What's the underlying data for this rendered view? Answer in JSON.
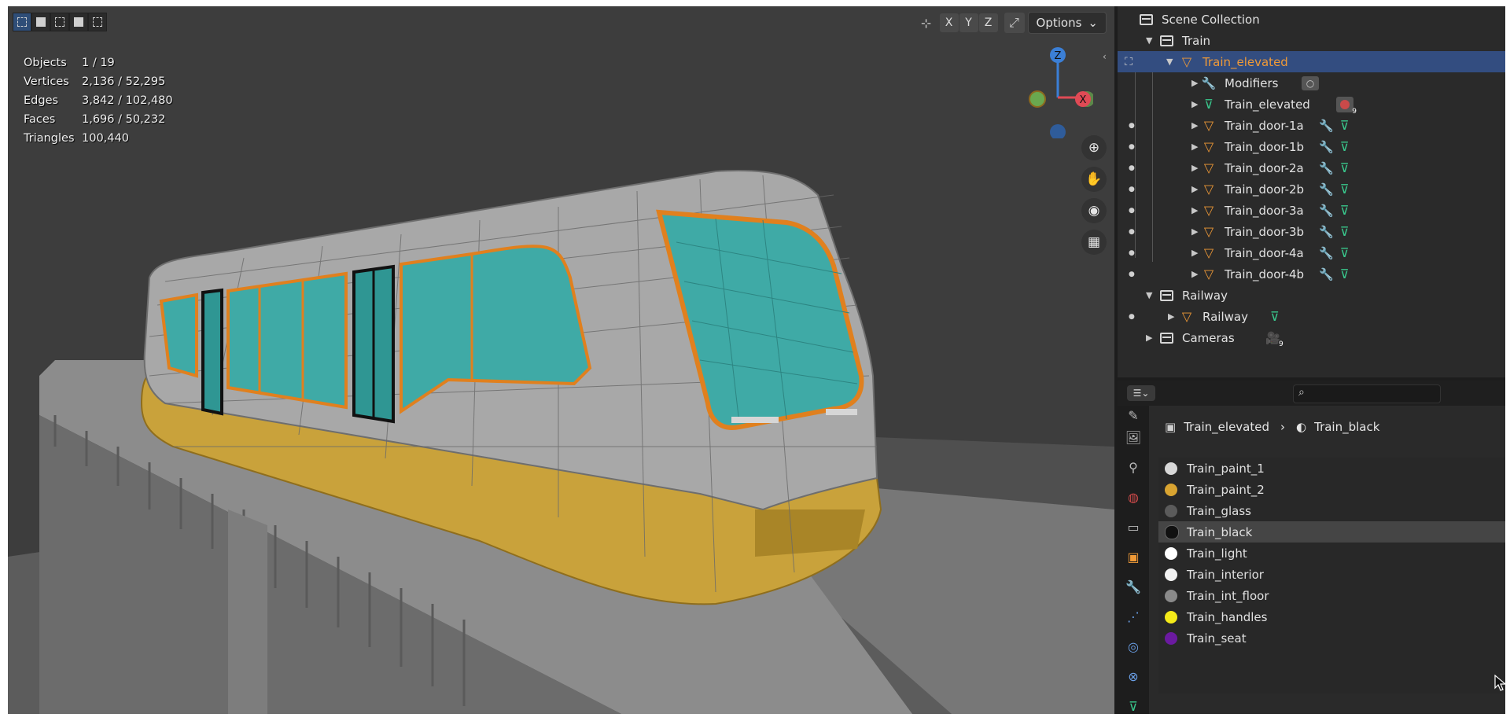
{
  "viewport": {
    "options_label": "Options",
    "axes": [
      "X",
      "Y",
      "Z"
    ],
    "stats": [
      {
        "label": "Objects",
        "value": "1 / 19"
      },
      {
        "label": "Vertices",
        "value": "2,136 / 52,295"
      },
      {
        "label": "Edges",
        "value": "3,842 / 102,480"
      },
      {
        "label": "Faces",
        "value": "1,696 / 50,232"
      },
      {
        "label": "Triangles",
        "value": "100,440"
      }
    ],
    "gizmo": {
      "z": "Z",
      "x": "X"
    }
  },
  "outliner": {
    "scene_collection": "Scene Collection",
    "train_collection": "Train",
    "train_elevated": "Train_elevated",
    "modifiers": "Modifiers",
    "mesh_data": "Train_elevated",
    "material_count": "9",
    "doors": [
      "Train_door-1a",
      "Train_door-1b",
      "Train_door-2a",
      "Train_door-2b",
      "Train_door-3a",
      "Train_door-3b",
      "Train_door-4a",
      "Train_door-4b"
    ],
    "railway_collection": "Railway",
    "railway_object": "Railway",
    "cameras_collection": "Cameras",
    "camera_count": "9"
  },
  "properties": {
    "breadcrumb": {
      "object": "Train_elevated",
      "material": "Train_black"
    },
    "materials": [
      {
        "name": "Train_paint_1",
        "color": "#d8d8d8"
      },
      {
        "name": "Train_paint_2",
        "color": "#d9a431"
      },
      {
        "name": "Train_glass",
        "color": "#5b5b5b"
      },
      {
        "name": "Train_black",
        "color": "#111111"
      },
      {
        "name": "Train_light",
        "color": "#ffffff"
      },
      {
        "name": "Train_interior",
        "color": "#f2f2f2"
      },
      {
        "name": "Train_int_floor",
        "color": "#8a8a8a"
      },
      {
        "name": "Train_handles",
        "color": "#f4ea19"
      },
      {
        "name": "Train_seat",
        "color": "#6b1aa0"
      }
    ],
    "active_material": "Train_black"
  },
  "colors": {
    "selection_highlight": "#334d80",
    "object_orange": "#f09a37",
    "train_yellow": "#c9a23b",
    "glass_teal": "#3faaa6"
  }
}
